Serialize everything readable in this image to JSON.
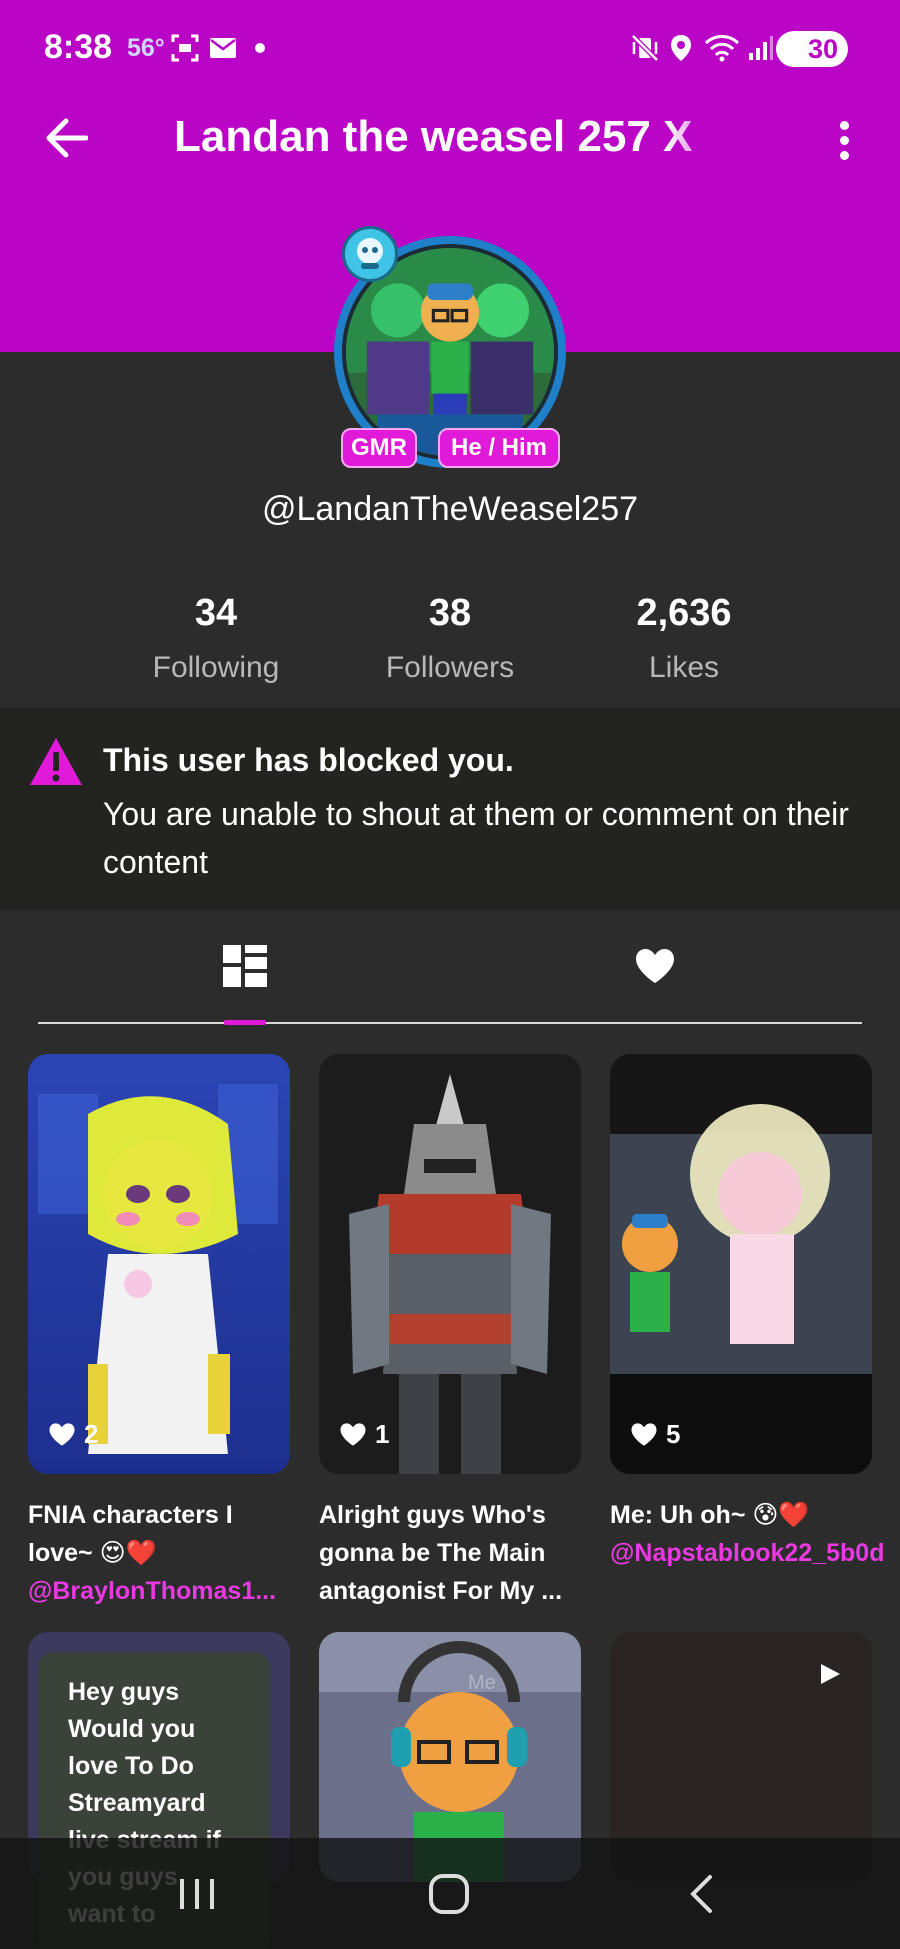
{
  "status_bar": {
    "time": "8:38",
    "temperature": "56°",
    "battery": "30",
    "icons": [
      "screenshot-icon",
      "mail-icon",
      "dot-icon",
      "mute-vibrate-icon",
      "location-icon",
      "wifi-icon",
      "signal-icon",
      "battery-icon"
    ]
  },
  "header": {
    "title": "Landan the weasel 257 X",
    "background": "#bb05c6"
  },
  "profile": {
    "badges": [
      "GMR",
      "He / Him"
    ],
    "handle": "@LandanTheWeasel257"
  },
  "stats": [
    {
      "value": "34",
      "label": "Following"
    },
    {
      "value": "38",
      "label": "Followers"
    },
    {
      "value": "2,636",
      "label": "Likes"
    }
  ],
  "blocked_notice": {
    "title": "This user has blocked you.",
    "text": "You are unable to shout at them or comment on their content",
    "icon_color": "#e01ad8"
  },
  "tabs": [
    "posts-grid-icon",
    "likes-heart-icon"
  ],
  "posts": [
    {
      "likes": "2",
      "caption": "FNIA characters I love~ 😍❤️",
      "mention": "@BraylonThomas1..."
    },
    {
      "likes": "1",
      "caption": "Alright guys Who's gonna be The Main antagonist For My ..."
    },
    {
      "likes": "5",
      "caption": "Me: Uh oh~ 😰❤️",
      "mention": "@Napstablook22_5b0d"
    }
  ],
  "second_row": {
    "text_post": "Hey guys Would you love To Do Streamyard live stream if you guys want to",
    "thumb_label": "Me"
  },
  "accent": "#e01ad8"
}
